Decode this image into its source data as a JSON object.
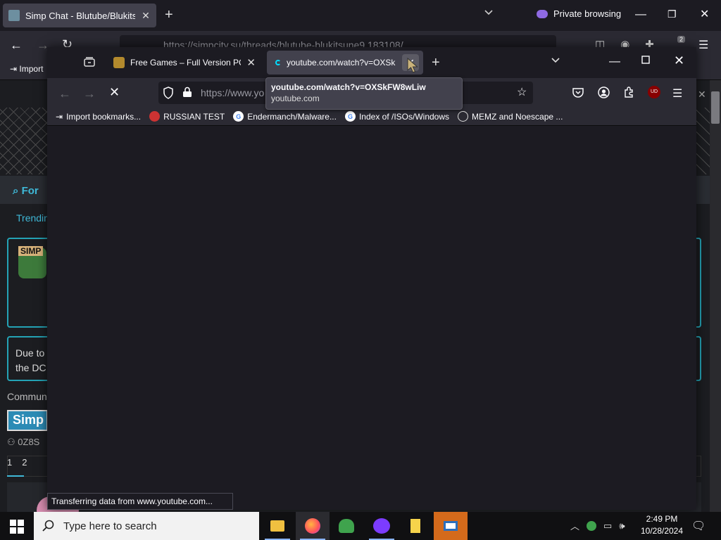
{
  "background_window": {
    "tab_title": "Simp Chat - Blutube/Blukitsune",
    "private_browsing_label": "Private browsing",
    "url": "https://simpcity.su/threads/blutube-blukitsune9.183108/",
    "bookmark_import": "Import",
    "extension_badge": "2",
    "page": {
      "nav_forums": "For",
      "nav_trending": "Trendin",
      "logo_text": "SIMP",
      "notice_line1": "Due to",
      "notice_line2": "the DC",
      "community_label": "Commun",
      "simp_button": "Simp",
      "username": "0Z8S",
      "pages": [
        "1",
        "2"
      ]
    }
  },
  "foreground_window": {
    "tabs": [
      {
        "title": "Free Games – Full Version PC Ga",
        "active": false
      },
      {
        "title": "youtube.com/watch?v=OXSk",
        "active": true
      }
    ],
    "url_text": "https://www.yo",
    "bookmarks": [
      {
        "label": "Import bookmarks...",
        "icon": "import-icon"
      },
      {
        "label": "RUSSIAN TEST",
        "icon": "search-red-icon"
      },
      {
        "label": "Endermanch/Malware...",
        "icon": "google-icon"
      },
      {
        "label": "Index of /ISOs/Windows",
        "icon": "google-icon"
      },
      {
        "label": "MEMZ and Noescape ...",
        "icon": "globe-icon"
      }
    ],
    "tooltip": {
      "url": "youtube.com/watch?v=OXSkFW8wLiw",
      "host": "youtube.com"
    },
    "status_text": "Transferring data from www.youtube.com...",
    "ublock_label": "UD"
  },
  "taskbar": {
    "search_placeholder": "Type here to search",
    "time": "2:49 PM",
    "date": "10/28/2024",
    "apps": [
      "file-explorer",
      "firefox",
      "people",
      "private-browser",
      "sticky-notes",
      "presentation-app"
    ]
  }
}
